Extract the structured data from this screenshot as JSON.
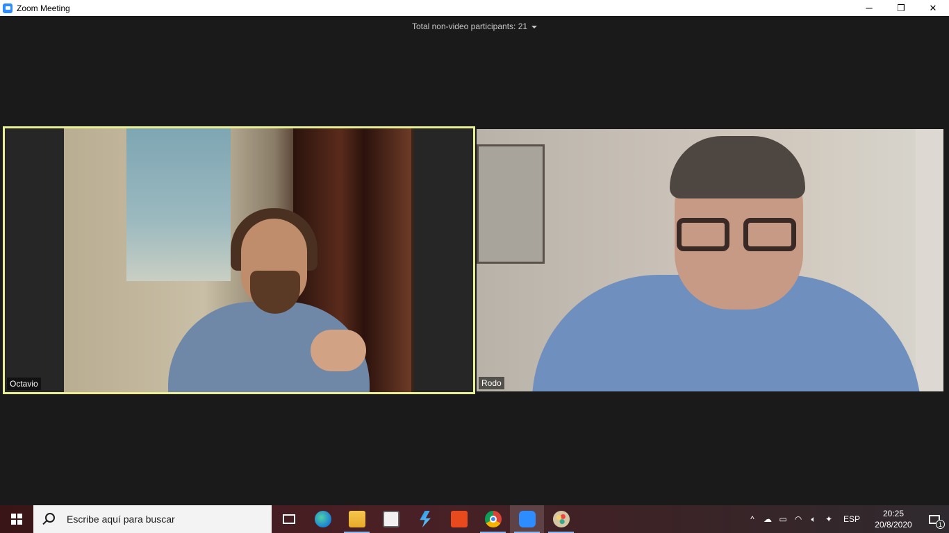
{
  "window": {
    "title": "Zoom Meeting",
    "controls": {
      "minimize": "─",
      "restore": "❐",
      "close": "✕"
    }
  },
  "meeting": {
    "non_video_label": "Total non-video participants: 21",
    "participants": [
      {
        "name": "Octavio",
        "active_speaker": true,
        "highlight_color": "#e8ef96"
      },
      {
        "name": "Rodo",
        "active_speaker": false
      }
    ]
  },
  "taskbar": {
    "search_placeholder": "Escribe aquí para buscar",
    "apps": [
      {
        "icon": "task-view-icon"
      },
      {
        "icon": "edge-icon"
      },
      {
        "icon": "file-explorer-icon"
      },
      {
        "icon": "microsoft-store-icon"
      },
      {
        "icon": "power-automate-icon"
      },
      {
        "icon": "office-icon"
      },
      {
        "icon": "chrome-icon"
      },
      {
        "icon": "zoom-icon",
        "active": true
      },
      {
        "icon": "paint-icon"
      }
    ],
    "tray": {
      "chevron": "^",
      "language": "ESP",
      "time": "20:25",
      "date": "20/8/2020",
      "notification_count": "1"
    }
  },
  "colors": {
    "background": "#1a1a1a",
    "active_border": "#e8ef96",
    "zoom_blue": "#2d8cff"
  }
}
